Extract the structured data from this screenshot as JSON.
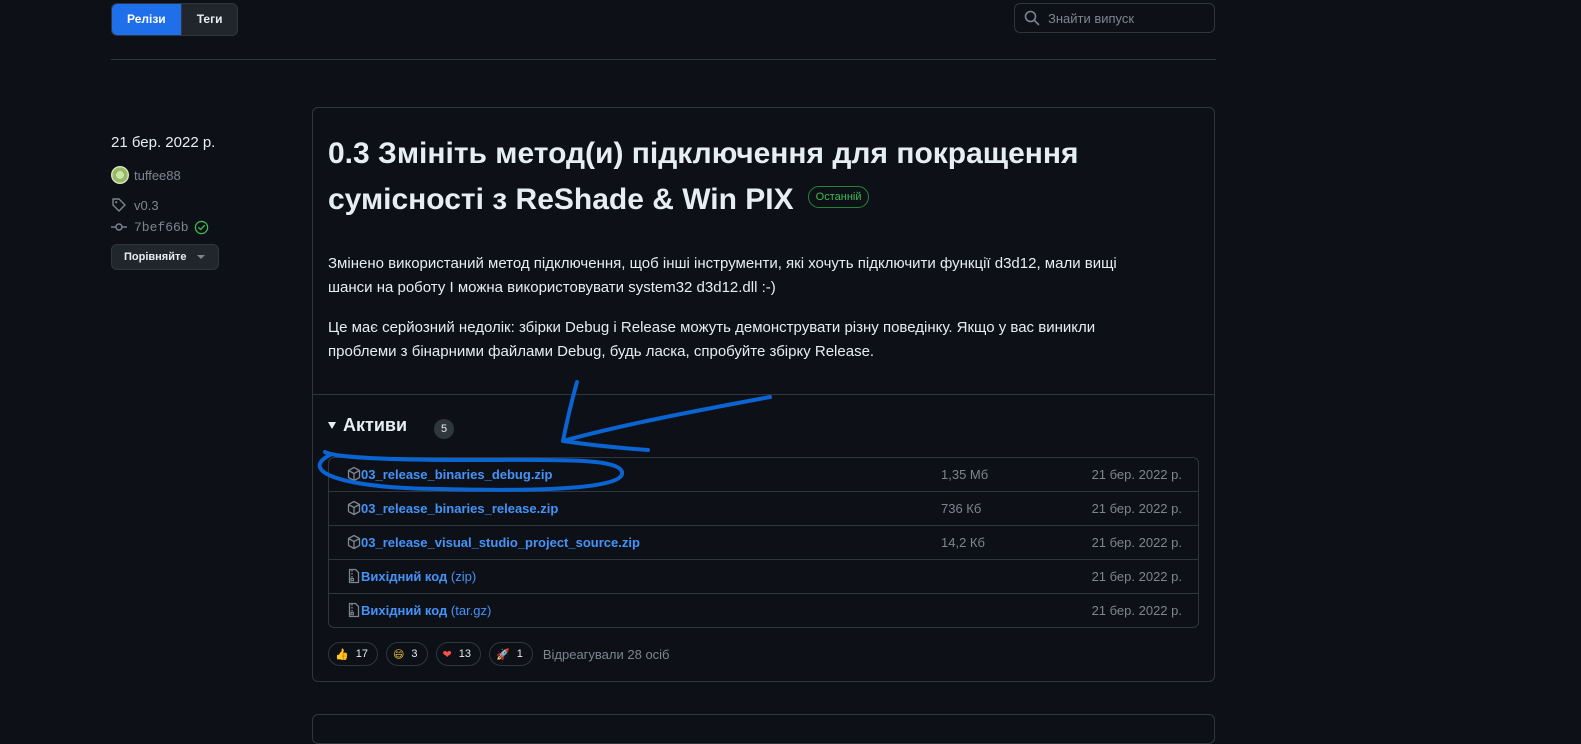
{
  "tabs": [
    {
      "label": "Релізи",
      "active": true
    },
    {
      "label": "Теги",
      "active": false
    }
  ],
  "search": {
    "placeholder": "Знайти випуск",
    "icon": "search-icon"
  },
  "release": {
    "date": "21 бер. 2022 р.",
    "author": "tuffee88",
    "tag": "v0.3",
    "commit": "7bef66b",
    "compare_label": "Порівняйте",
    "title": "0.3 Змініть метод(и) підключення для покращення сумісності з ReShade & Win PIX",
    "latest_badge": "Останній",
    "body": [
      "Змінено використаний метод підключення, щоб інші інструменти, які хочуть підключити функції d3d12, мали вищі шанси на роботу І можна використовувати system32 d3d12.dll :-)",
      "Це має серйозний недолік: збірки Debug і Release можуть демонструвати різну поведінку. Якщо у вас виникли проблеми з бінарними файлами Debug, будь ласка, спробуйте збірку Release."
    ],
    "assets_label": "Активи",
    "assets_count": "5",
    "assets": [
      {
        "name": "03_release_binaries_debug.zip",
        "suffix": "",
        "size": "1,35 Мб",
        "date": "21 бер. 2022 р.",
        "icon": "package-icon"
      },
      {
        "name": "03_release_binaries_release.zip",
        "suffix": "",
        "size": "736 Кб",
        "date": "21 бер. 2022 р.",
        "icon": "package-icon"
      },
      {
        "name": "03_release_visual_studio_project_source.zip",
        "suffix": "",
        "size": "14,2 Кб",
        "date": "21 бер. 2022 р.",
        "icon": "package-icon"
      },
      {
        "name": "Вихідний код",
        "suffix": " (zip)",
        "size": "",
        "date": "21 бер. 2022 р.",
        "icon": "file-zip-icon"
      },
      {
        "name": "Вихідний код",
        "suffix": " (tar.gz)",
        "size": "",
        "date": "21 бер. 2022 р.",
        "icon": "file-zip-icon"
      }
    ],
    "reactions": [
      {
        "emoji": "👍",
        "count": "17",
        "icon": "thumbs-up-icon"
      },
      {
        "emoji": "😄",
        "count": "3",
        "icon": "laugh-icon"
      },
      {
        "emoji": "❤",
        "count": "13",
        "icon": "heart-icon"
      },
      {
        "emoji": "🚀",
        "count": "1",
        "icon": "rocket-icon"
      }
    ],
    "reacted_text": "Відреагували 28 осіб"
  },
  "colors": {
    "accent": "#1f6feb",
    "link": "#4493f8",
    "badge_green": "#3fb950",
    "annotation": "#0a64d2"
  }
}
